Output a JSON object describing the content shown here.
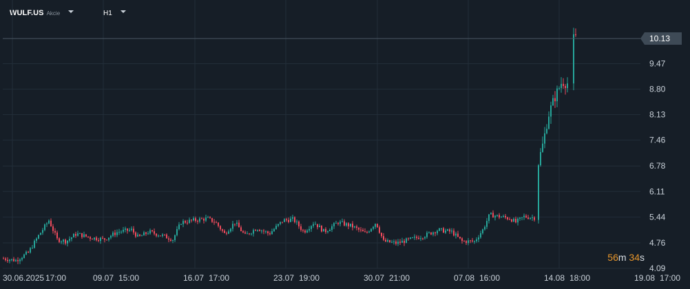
{
  "header": {
    "symbol": "WULF.US",
    "symbol_type": "Akcie",
    "timeframe": "H1"
  },
  "countdown": {
    "minutes": "56",
    "minutes_unit": "m",
    "seconds": "34",
    "seconds_unit": "s"
  },
  "colors": {
    "background": "#161e27",
    "grid": "#222d38",
    "up": "#26a69a",
    "down": "#ef4b5c",
    "price_line": "#4a5663",
    "price_tag": "#3e4a56",
    "countdown_number": "#e8962b"
  },
  "chart_data": {
    "type": "candlestick",
    "symbol": "WULF.US",
    "timeframe": "H1",
    "ylim": [
      4.09,
      10.78
    ],
    "y_ticks": [
      "4.09",
      "4.76",
      "5.44",
      "6.11",
      "6.78",
      "7.46",
      "8.13",
      "8.80",
      "9.47",
      "10.13"
    ],
    "x_ticks": [
      "30.06.2025",
      "17:00",
      "09.07",
      "15:00",
      "16.07",
      "17:00",
      "23.07",
      "19:00",
      "30.07",
      "21:00",
      "07.08",
      "16:00",
      "14.08",
      "18:00",
      "19.08",
      "17:00"
    ],
    "current_price": "10.13",
    "grid": true,
    "legend": "none"
  }
}
